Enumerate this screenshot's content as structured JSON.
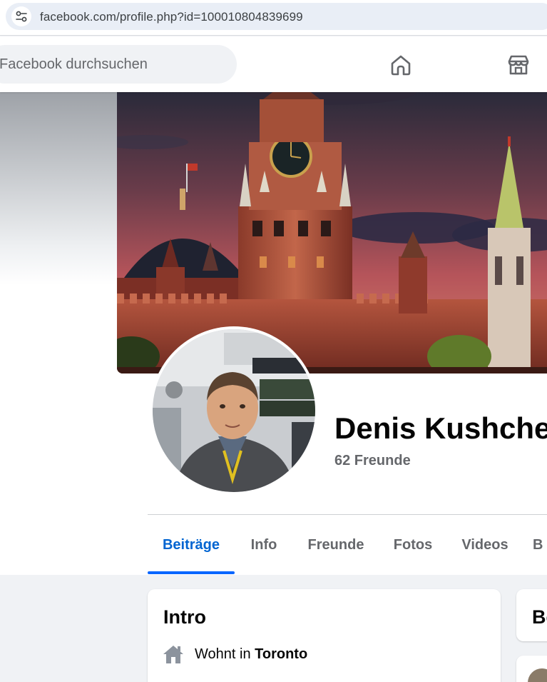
{
  "browser": {
    "url": "facebook.com/profile.php?id=100010804839699"
  },
  "header": {
    "search_placeholder": "Facebook durchsuchen",
    "nav_icons": [
      "home-icon",
      "marketplace-icon"
    ]
  },
  "profile": {
    "name": "Denis Kushche",
    "friends": "62 Freunde"
  },
  "tabs": [
    {
      "label": "Beiträge",
      "active": true
    },
    {
      "label": "Info"
    },
    {
      "label": "Freunde"
    },
    {
      "label": "Fotos"
    },
    {
      "label": "Videos"
    },
    {
      "label": "B"
    }
  ],
  "intro": {
    "title": "Intro",
    "lives_prefix": "Wohnt in",
    "city": "Toronto"
  },
  "right_card": {
    "title_partial": "Be"
  },
  "colors": {
    "accent": "#0064d1",
    "tab_underline": "#0866ff",
    "secondary_text": "#65676b"
  }
}
